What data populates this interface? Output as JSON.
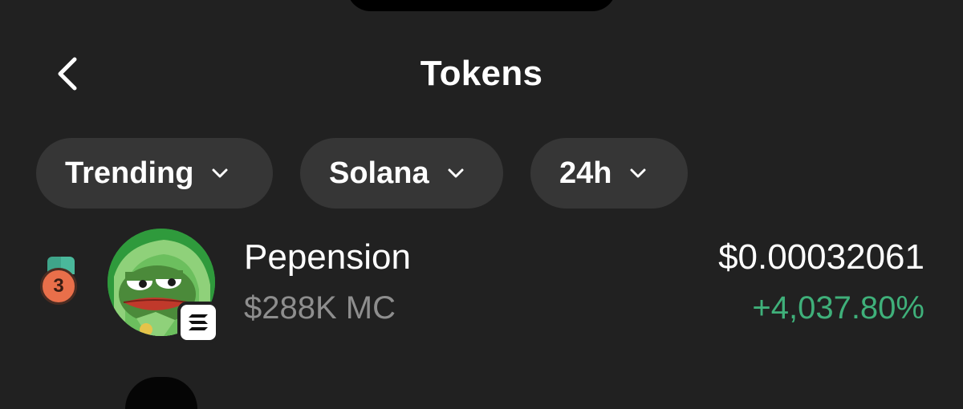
{
  "header": {
    "title": "Tokens",
    "back_icon": "chevron-left-icon"
  },
  "filters": [
    {
      "label": "Trending",
      "icon": "chevron-down-icon"
    },
    {
      "label": "Solana",
      "icon": "chevron-down-icon"
    },
    {
      "label": "24h",
      "icon": "chevron-down-icon"
    }
  ],
  "tokens": [
    {
      "rank": "3",
      "name": "Pepension",
      "market_cap": "$288K MC",
      "price": "$0.00032061",
      "change": "+4,037.80%",
      "chain_icon": "solana-icon"
    }
  ],
  "colors": {
    "background": "#212121",
    "pill_background": "#363636",
    "positive_change": "#3fb07a",
    "muted_text": "#8e8e8e",
    "medal": "#e96f4a"
  }
}
